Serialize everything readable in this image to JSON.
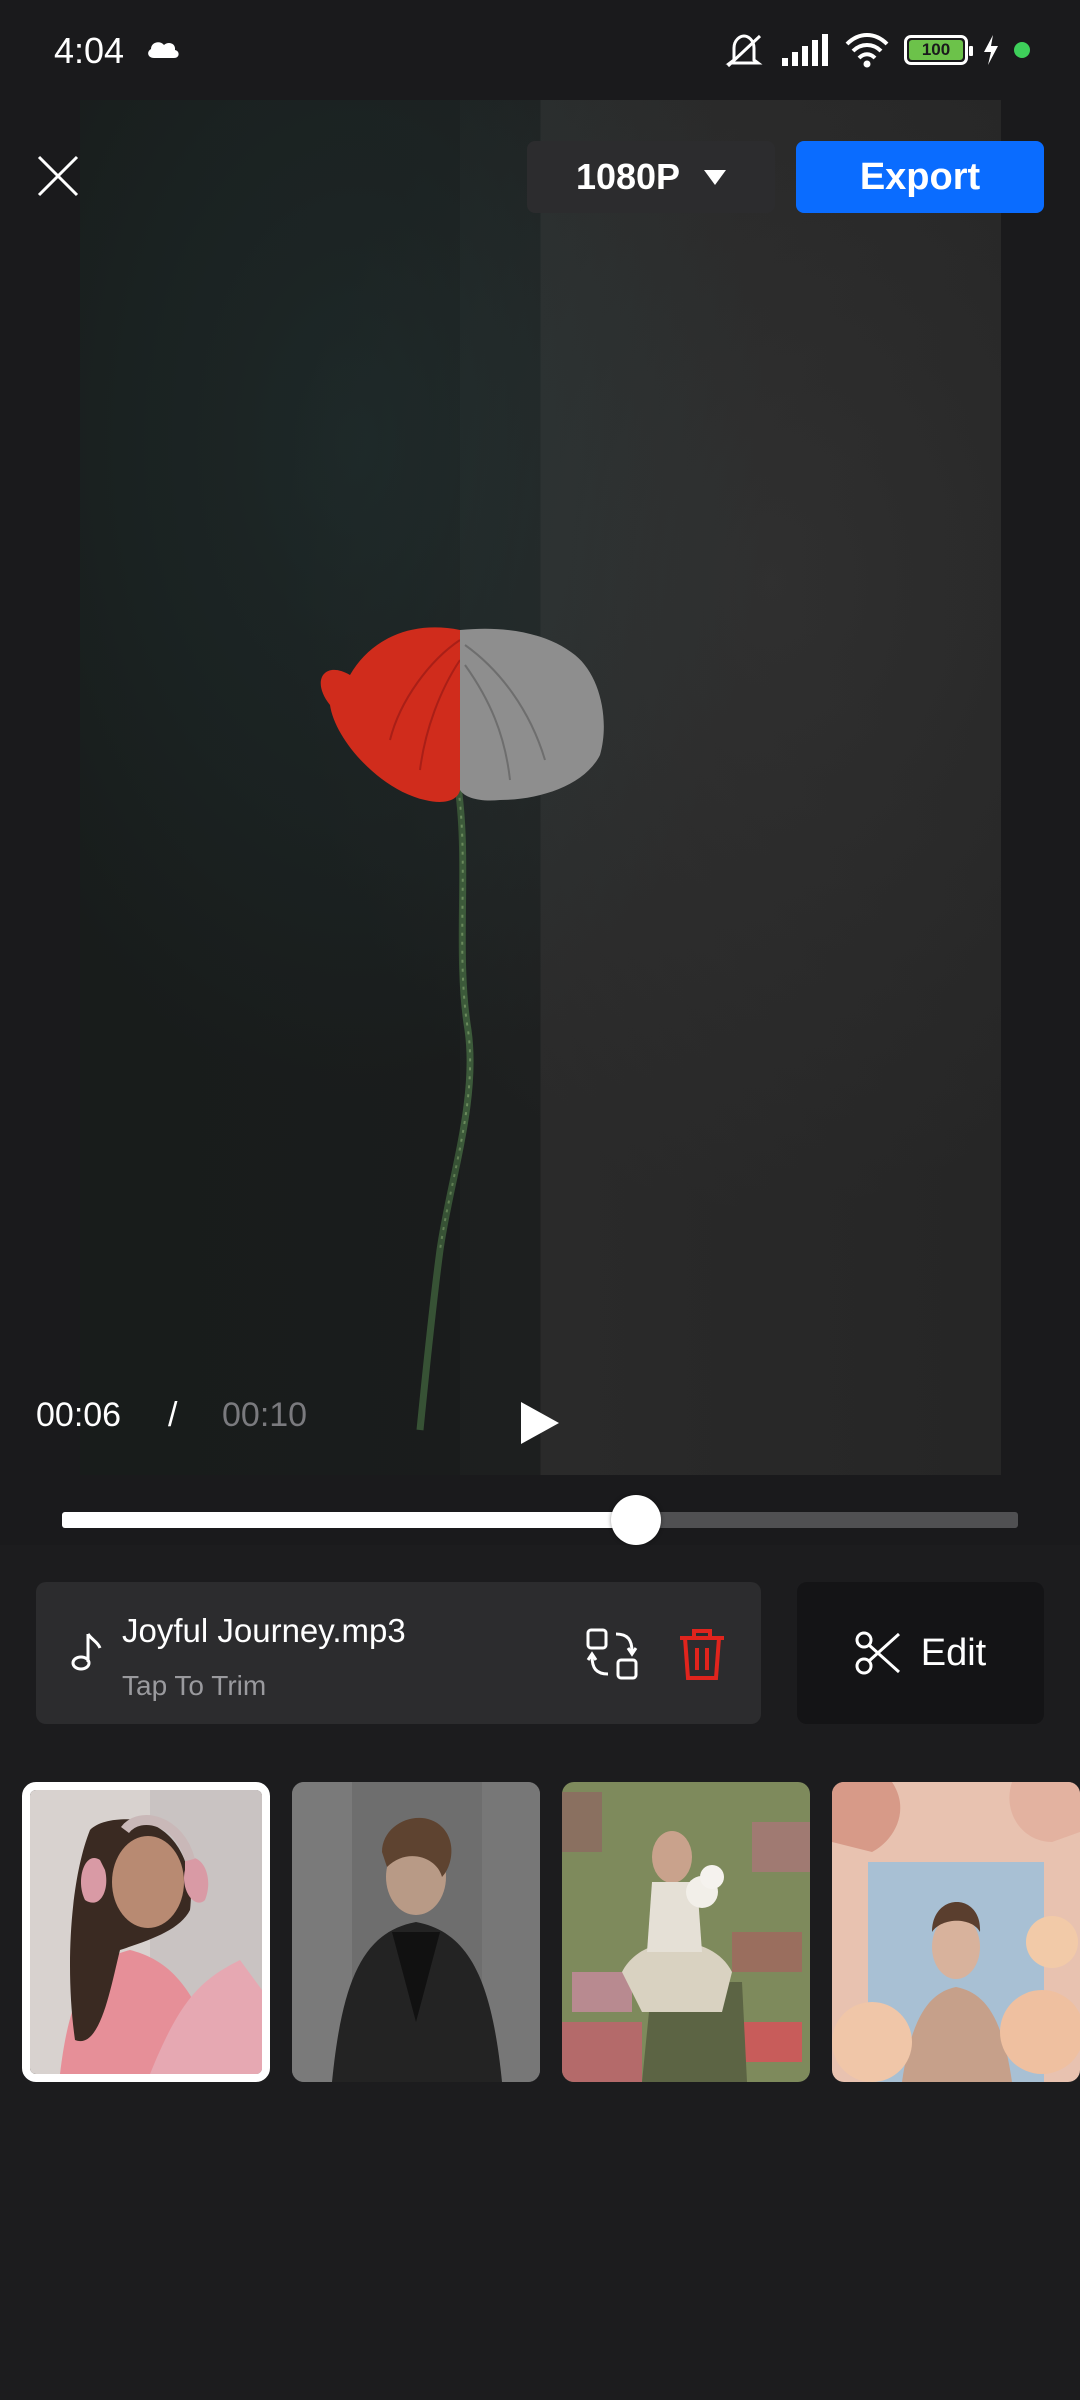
{
  "status_bar": {
    "time": "4:04",
    "battery": "100",
    "icons": [
      "cloud-icon",
      "mute-icon",
      "signal-icon",
      "wifi-icon",
      "battery-icon",
      "charging-icon",
      "dot-icon"
    ]
  },
  "header": {
    "close_icon": "close-icon",
    "resolution": "1080P",
    "export_label": "Export",
    "export_color": "#0a6cff"
  },
  "player": {
    "current_time": "00:06",
    "separator": "/",
    "total_time": "00:10",
    "progress": 0.6
  },
  "music": {
    "title": "Joyful Journey.mp3",
    "subtitle": "Tap To Trim",
    "delete_color": "#e0241d"
  },
  "edit": {
    "label": "Edit"
  },
  "thumbnails": {
    "selected_index": 0,
    "count": 4
  }
}
